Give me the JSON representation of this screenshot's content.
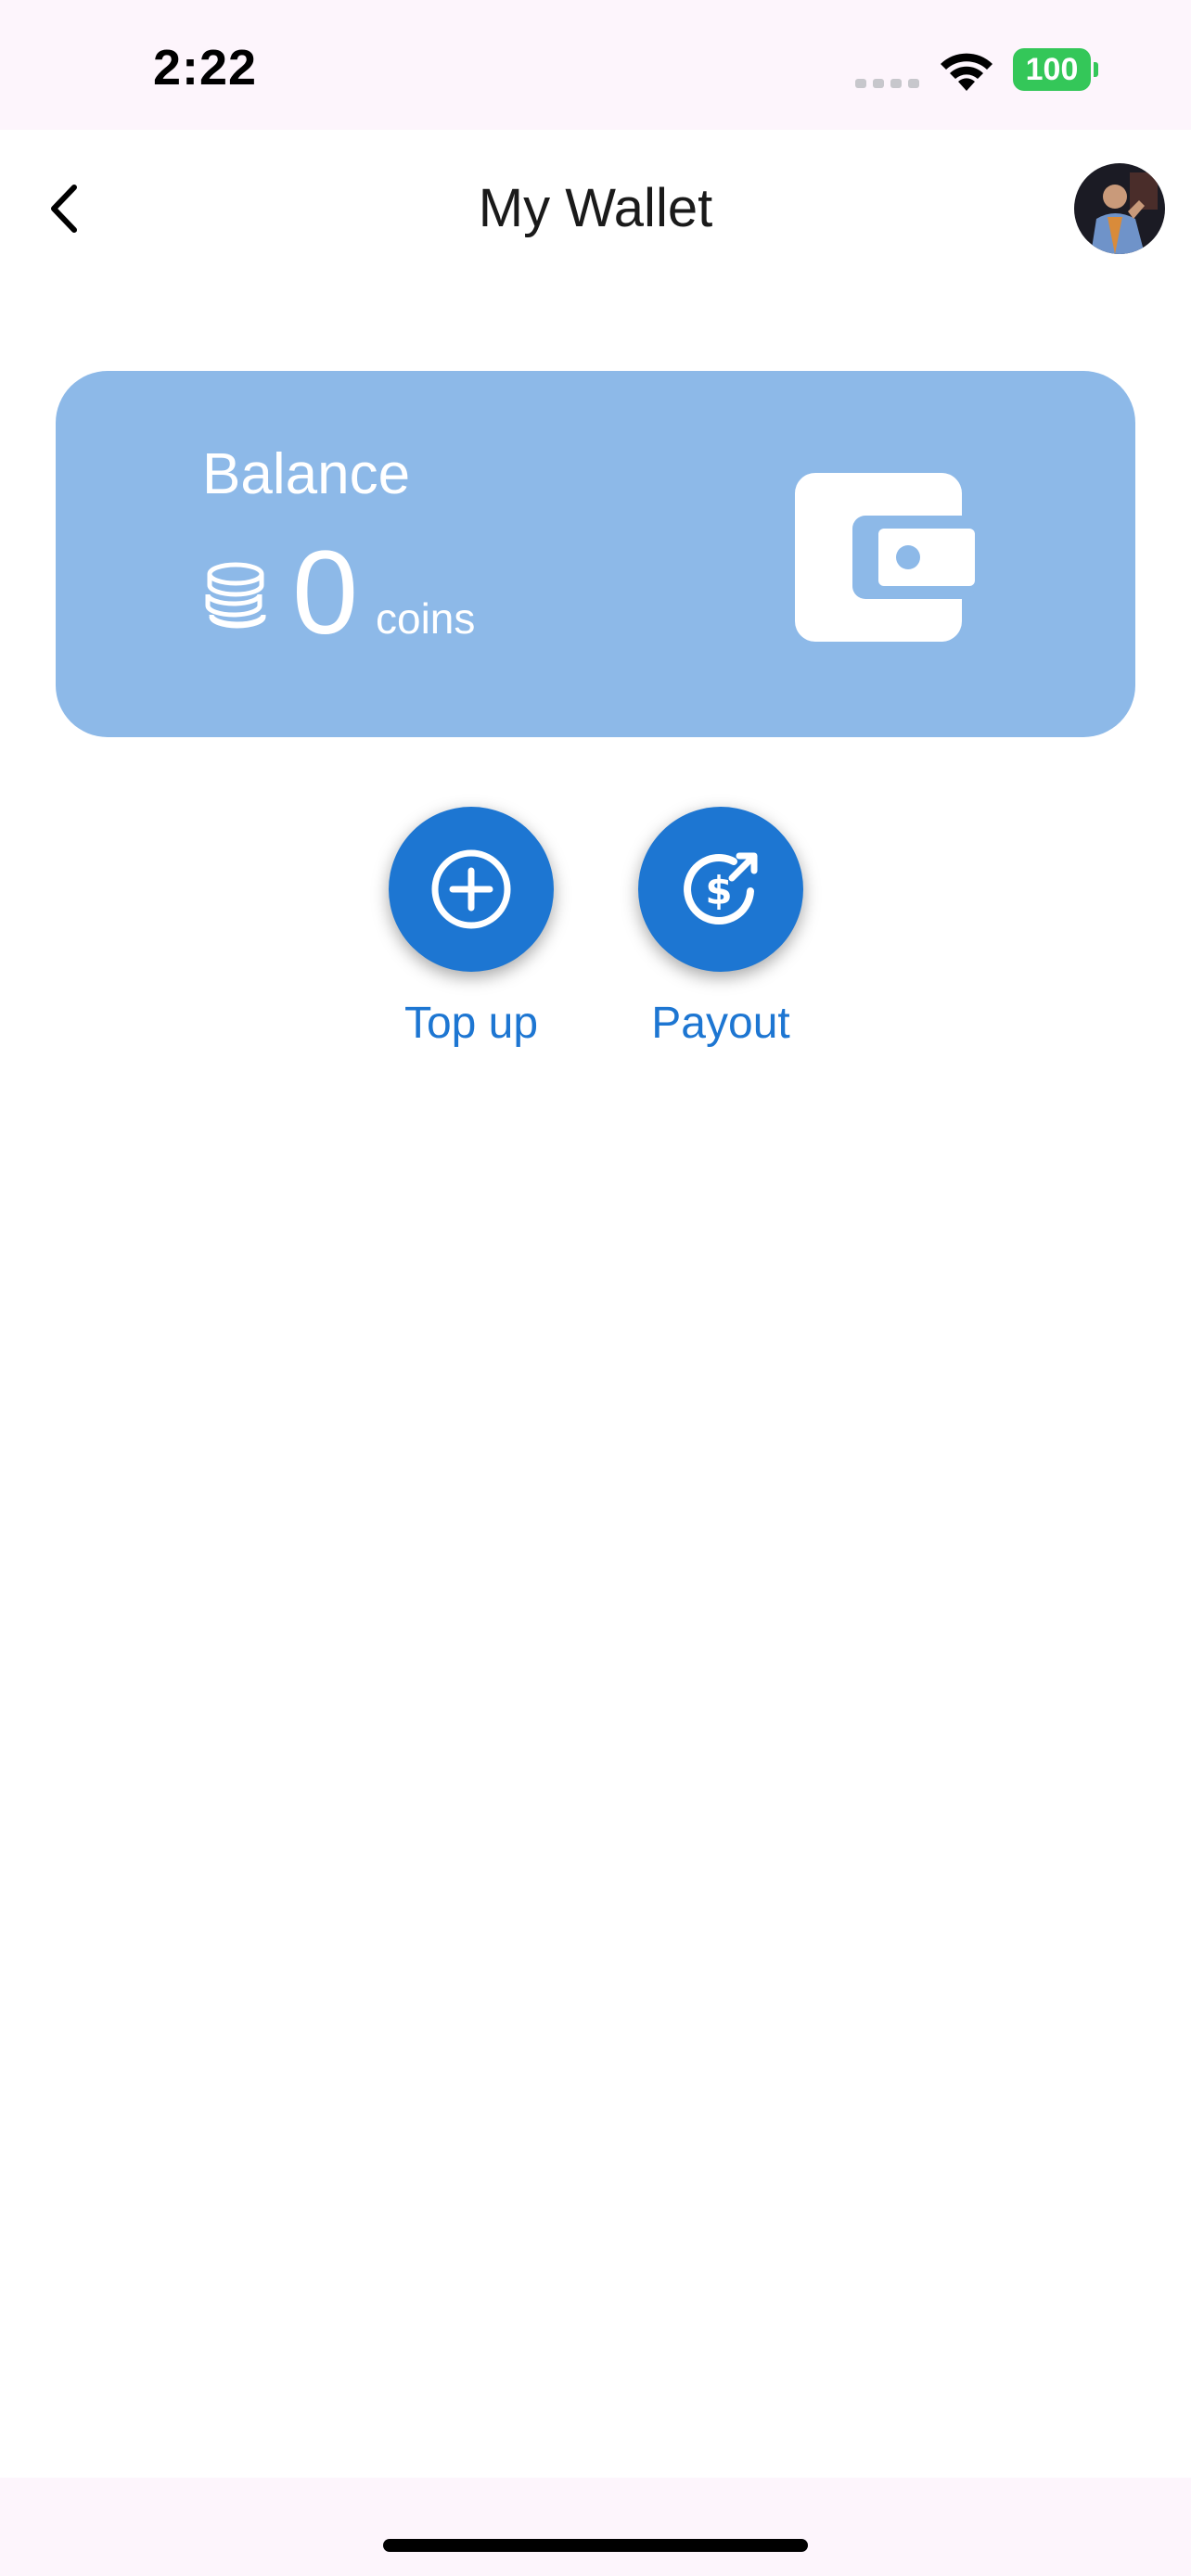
{
  "status_bar": {
    "time": "2:22",
    "battery_level": "100"
  },
  "header": {
    "title": "My Wallet",
    "back_icon": "chevron-left-icon",
    "avatar_icon": "user-avatar"
  },
  "balance_card": {
    "label": "Balance",
    "value": "0",
    "unit": "coins",
    "card_color": "#8db9e8",
    "icon_coins": "coins-icon",
    "icon_wallet": "wallet-icon"
  },
  "actions": [
    {
      "label": "Top up",
      "icon": "plus-circle-icon"
    },
    {
      "label": "Payout",
      "icon": "dollar-payout-icon"
    }
  ],
  "colors": {
    "accent": "#1d76d2",
    "status_bar_bg": "#fdf5fc",
    "battery": "#34c759"
  }
}
